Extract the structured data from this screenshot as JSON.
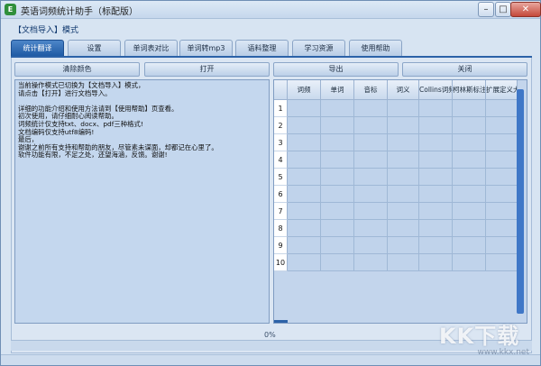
{
  "window": {
    "title": "英语词频统计助手（标配版）",
    "app_icon_glyph": "E",
    "minimize_glyph": "–",
    "maximize_glyph": "□",
    "close_glyph": "✕"
  },
  "mode_label": "【文档导入】模式",
  "tabs": [
    {
      "label": "统计翻译",
      "active": true
    },
    {
      "label": "设置",
      "active": false
    },
    {
      "label": "单词表对比",
      "active": false
    },
    {
      "label": "单词转mp3",
      "active": false
    },
    {
      "label": "语料整理",
      "active": false
    },
    {
      "label": "学习资源",
      "active": false
    },
    {
      "label": "使用帮助",
      "active": false
    }
  ],
  "actions": {
    "clear_colors": "清除颜色",
    "open": "打开",
    "export": "导出",
    "close": "关闭"
  },
  "log_text": "当前操作模式已切换为【文档导入】模式，\n请点击【打开】进行文档导入。\n\n详细的功能介绍和使用方法请到【使用帮助】页查看。\n初次使用，请仔细耐心阅读帮助。\n词频统计仅支持txt、docx、pdf三种格式!\n文档编码仅支持utf8编码!\n最后，\n谢谢之前所有支持和帮助的朋友，尽管素未谋面，却都记在心里了。\n软件功能有限，不足之处，还望海涵，反馈。谢谢!",
  "table": {
    "columns": [
      "词频",
      "单词",
      "音标",
      "词义",
      "Collins词频",
      "柯林斯标注大纲",
      "扩展定义大纲"
    ],
    "rows": [
      "1",
      "2",
      "3",
      "4",
      "5",
      "6",
      "7",
      "8",
      "9",
      "10"
    ]
  },
  "progress": {
    "label": "0%",
    "value": 0
  },
  "watermark": {
    "logo": "KK下载",
    "url": "www.kkx.net"
  },
  "colors": {
    "active_tab": "#1f5aa5",
    "panel": "#dbe6f3",
    "grid_cells": "#c0d3eb",
    "scrollbar": "#3f77c7"
  }
}
